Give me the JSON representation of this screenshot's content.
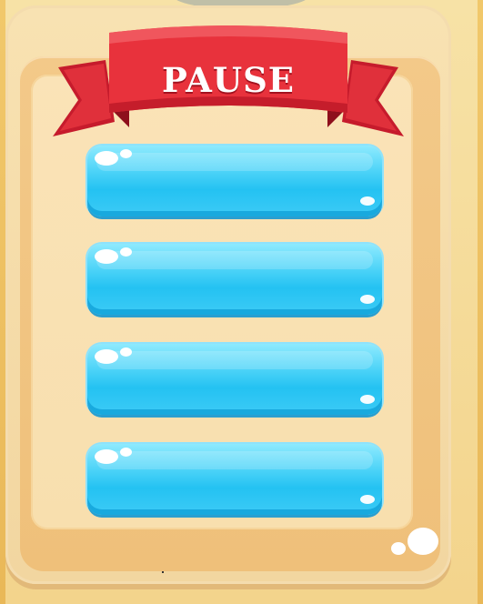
{
  "pause_dialog": {
    "title": "PAUSE",
    "buttons": [
      {
        "label": ""
      },
      {
        "label": ""
      },
      {
        "label": ""
      },
      {
        "label": ""
      }
    ]
  },
  "colors": {
    "ribbon": "#e0262f",
    "button": "#2ec5f3",
    "panel": "#f8dfae",
    "frame": "#efc07a"
  },
  "icons": [
    "ribbon-banner",
    "bubble-decoration"
  ]
}
